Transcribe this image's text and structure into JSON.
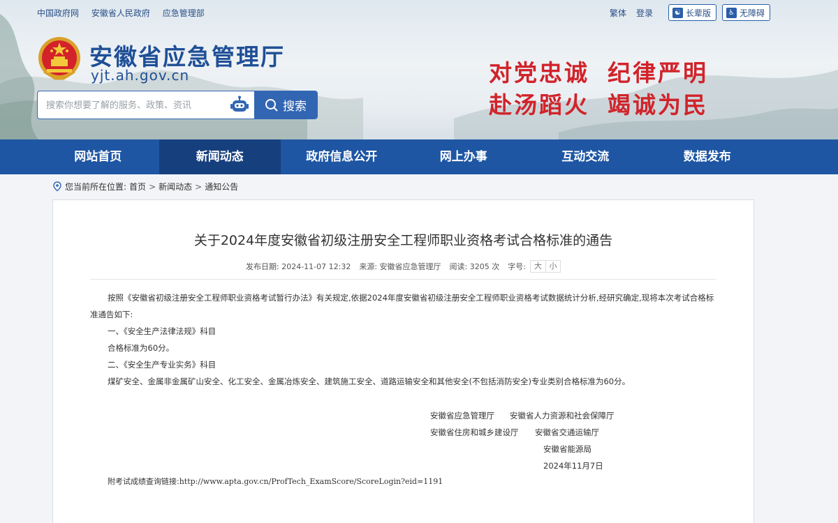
{
  "topbar": {
    "links": [
      "中国政府网",
      "安徽省人民政府",
      "应急管理部"
    ],
    "traditional": "繁体",
    "login": "登录",
    "elder_mode": "长辈版",
    "accessible": "无障碍"
  },
  "header": {
    "site_name": "安徽省应急管理厅",
    "site_url": "yjt.ah.gov.cn",
    "slogan_line1": [
      "对党忠诚",
      "纪律严明"
    ],
    "slogan_line2": [
      "赴汤蹈火",
      "竭诚为民"
    ]
  },
  "search": {
    "placeholder": "搜索你想要了解的服务、政策、资讯",
    "button": "搜索"
  },
  "nav": {
    "items": [
      "网站首页",
      "新闻动态",
      "政府信息公开",
      "网上办事",
      "互动交流",
      "数据发布"
    ],
    "active": "新闻动态"
  },
  "breadcrumb": {
    "prefix": "您当前所在位置:",
    "items": [
      "首页",
      "新闻动态",
      "通知公告"
    ]
  },
  "article": {
    "title": "关于2024年度安徽省初级注册安全工程师职业资格考试合格标准的通告",
    "publish_date": "发布日期: 2024-11-07 12:32",
    "source": "来源: 安徽省应急管理厅",
    "views": "阅读: 3205 次",
    "font_label": "字号:",
    "font_large": "大",
    "font_small": "小",
    "intro": "按照《安徽省初级注册安全工程师职业资格考试暂行办法》有关规定,依据2024年度安徽省初级注册安全工程师职业资格考试数据统计分析,经研究确定,现将本次考试合格标准通告如下:",
    "item1_title": "一、《安全生产法律法规》科目",
    "item1_value": "合格标准为60分。",
    "item2_title": "二、《安全生产专业实务》科目",
    "item2_value": "煤矿安全、金属非金属矿山安全、化工安全、金属冶炼安全、建筑施工安全、道路运输安全和其他安全(不包括消防安全)专业类别合格标准为60分。",
    "signatures": {
      "row1_a": "安徽省应急管理厅",
      "row1_b": "安徽省人力资源和社会保障厅",
      "row2_a": "安徽省住房和城乡建设厅",
      "row2_b": "安徽省交通运输厅",
      "row3": "安徽省能源局",
      "date": "2024年11月7日"
    },
    "link_label": "附考试成绩查询链接:",
    "link_url": "http://www.apta.gov.cn/ProfTech_ExamScore/ScoreLogin?eid=1191"
  }
}
